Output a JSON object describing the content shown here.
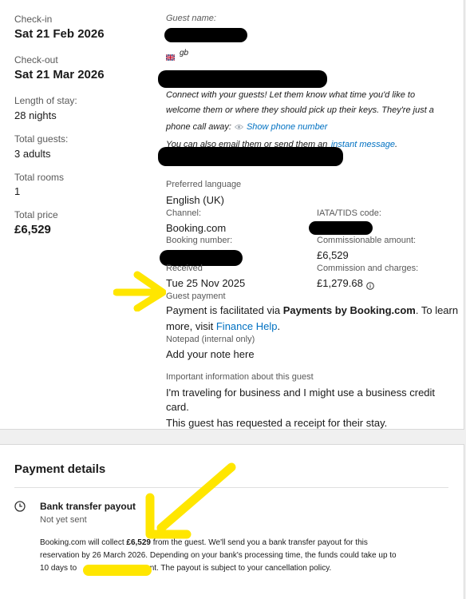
{
  "stay": {
    "checkin_label": "Check-in",
    "checkin_value": "Sat 21 Feb 2026",
    "checkout_label": "Check-out",
    "checkout_value": "Sat 21 Mar 2026",
    "length_label": "Length of stay:",
    "length_value": "28 nights",
    "guests_label": "Total guests:",
    "guests_value": "3 adults",
    "rooms_label": "Total rooms",
    "rooms_value": "1",
    "price_label": "Total price",
    "price_value": "£6,529"
  },
  "guest": {
    "name_label": "Guest name:",
    "country_code": "gb",
    "connect_text_1": "Connect with your guests! Let them know what time you'd like to",
    "connect_text_2": "welcome them or where they should pick up their keys. They're just a",
    "connect_text_3": "phone call away:",
    "show_phone": "Show phone number",
    "email_text": "You can also email them or send them an",
    "instant_message": "instant message",
    "email_text_end": "."
  },
  "booking": {
    "pref_lang_label": "Preferred language",
    "pref_lang_value": "English (UK)",
    "channel_label": "Channel:",
    "channel_value": "Booking.com",
    "iata_label": "IATA/TIDS code:",
    "booking_number_label": "Booking number:",
    "commissionable_label": "Commissionable amount:",
    "commissionable_value": "£6,529",
    "received_label": "Received",
    "received_value": "Tue 25 Nov 2025",
    "commission_label": "Commission and charges:",
    "commission_value": "£1,279.68",
    "guest_payment_label": "Guest payment",
    "payment_text_1": "Payment is facilitated via",
    "payment_bold": "Payments by Booking.com",
    "payment_text_2": ". To learn",
    "payment_text_3": "more, visit",
    "finance_help": "Finance Help",
    "payment_text_4": ".",
    "notepad_label": "Notepad (internal only)",
    "add_note": "Add your note here",
    "important_label": "Important information about this guest",
    "important_text_1": "I'm traveling for business and I might use a business credit",
    "important_text_2": "card.",
    "receipt_text": "This guest has requested a receipt for their stay."
  },
  "payment_details": {
    "title": "Payment details",
    "payout_title": "Bank transfer payout",
    "payout_status": "Not yet sent",
    "desc_1_a": "Booking.com will collect",
    "desc_1_amount": "£6,529",
    "desc_1_b": "from the guest. We'll send you a bank transfer payout for this",
    "desc_2": "reservation by 26 March 2026. Depending on your bank's processing time, the funds could take up to",
    "desc_3_a": "10 days to",
    "desc_3_b": "nt. The payout is subject to your cancellation policy."
  },
  "colors": {
    "link": "#0071c2",
    "annotation": "#ffe600"
  },
  "icons": {
    "info": "info-icon",
    "eye": "eye-icon",
    "clock": "clock-icon",
    "flag": "gb-flag-icon"
  }
}
